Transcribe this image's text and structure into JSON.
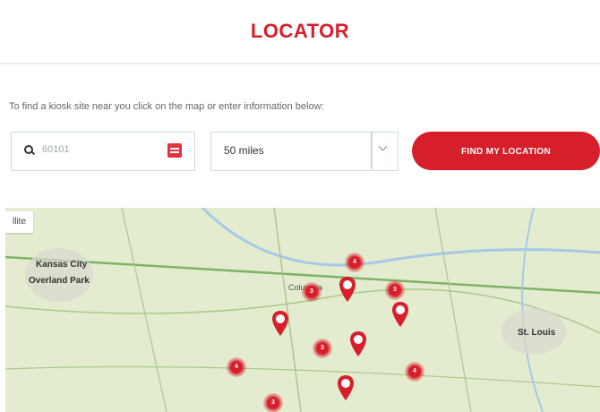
{
  "header": {
    "title": "LOCATOR"
  },
  "instructions": "To find a kiosk site near you click on the map or enter information below:",
  "search": {
    "zip_value": "60101",
    "radius_value": "50 miles"
  },
  "find_button": {
    "label": "FIND MY LOCATION"
  },
  "map": {
    "type_toggle": "llite",
    "cities": [
      {
        "name": "Kansas City",
        "major": true
      },
      {
        "name": "Overland Park",
        "major": true
      },
      {
        "name": "Columbia",
        "major": false
      },
      {
        "name": "St. Louis",
        "major": true
      }
    ],
    "clusters": [
      "4",
      "3",
      "3",
      "3",
      "4",
      "4",
      "3",
      "3"
    ],
    "pin_count": 5
  },
  "colors": {
    "brand_red": "#d71f2b",
    "map_land": "#e4eccf",
    "road_green": "#7fb26a",
    "water": "#a8c8e8"
  }
}
